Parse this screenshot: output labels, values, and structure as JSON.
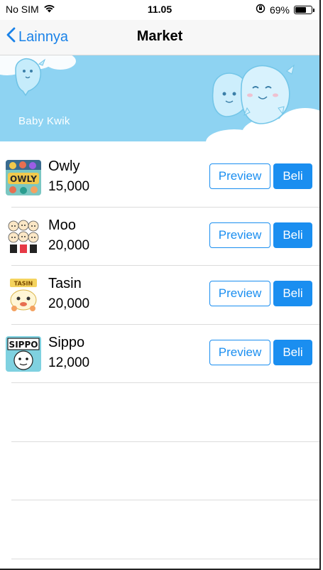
{
  "status_bar": {
    "carrier": "No SIM",
    "time": "11.05",
    "battery_percent": "69%",
    "battery_level": 0.69
  },
  "nav": {
    "back_label": "Lainnya",
    "title": "Market"
  },
  "banner": {
    "label": "Baby Kwik",
    "background": "#8ed3f2"
  },
  "items": [
    {
      "name": "Owly",
      "price": "15,000",
      "preview_label": "Preview",
      "buy_label": "Beli",
      "thumb_icon": "owly-sticker-icon"
    },
    {
      "name": "Moo",
      "price": "20,000",
      "preview_label": "Preview",
      "buy_label": "Beli",
      "thumb_icon": "moo-sticker-icon"
    },
    {
      "name": "Tasin",
      "price": "20,000",
      "preview_label": "Preview",
      "buy_label": "Beli",
      "thumb_icon": "tasin-sticker-icon"
    },
    {
      "name": "Sippo",
      "price": "12,000",
      "preview_label": "Preview",
      "buy_label": "Beli",
      "thumb_icon": "sippo-sticker-icon"
    }
  ],
  "colors": {
    "accent": "#1a8ef0",
    "banner": "#8ed3f2"
  }
}
